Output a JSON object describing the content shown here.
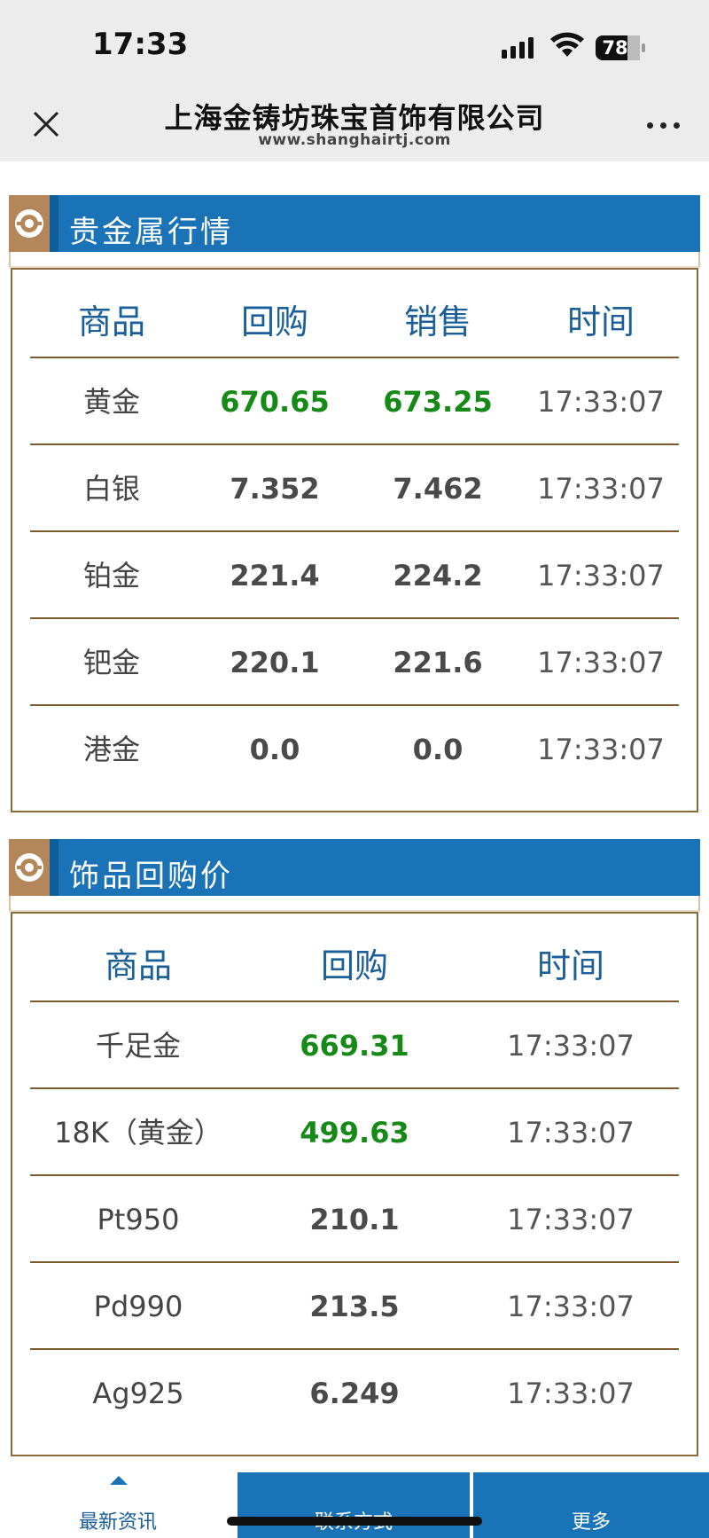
{
  "status_bar": {
    "time": "17:33",
    "battery": "78"
  },
  "header": {
    "title": "上海金铸坊珠宝首饰有限公司",
    "url": "www.shanghairtj.com"
  },
  "precious_metals": {
    "title": "贵金属行情",
    "columns": [
      "商品",
      "回购",
      "销售",
      "时间"
    ],
    "rows": [
      {
        "name": "黄金",
        "buyback": "670.65",
        "sale": "673.25",
        "time": "17:33:07",
        "highlight": true
      },
      {
        "name": "白银",
        "buyback": "7.352",
        "sale": "7.462",
        "time": "17:33:07",
        "highlight": false
      },
      {
        "name": "铂金",
        "buyback": "221.4",
        "sale": "224.2",
        "time": "17:33:07",
        "highlight": false
      },
      {
        "name": "钯金",
        "buyback": "220.1",
        "sale": "221.6",
        "time": "17:33:07",
        "highlight": false
      },
      {
        "name": "港金",
        "buyback": "0.0",
        "sale": "0.0",
        "time": "17:33:07",
        "highlight": false
      }
    ]
  },
  "jewelry_buyback": {
    "title": "饰品回购价",
    "columns": [
      "商品",
      "回购",
      "时间"
    ],
    "rows": [
      {
        "name": "千足金",
        "buyback": "669.31",
        "time": "17:33:07",
        "highlight": true
      },
      {
        "name": "18K（黄金）",
        "buyback": "499.63",
        "time": "17:33:07",
        "highlight": true
      },
      {
        "name": "Pt950",
        "buyback": "210.1",
        "time": "17:33:07",
        "highlight": false
      },
      {
        "name": "Pd990",
        "buyback": "213.5",
        "time": "17:33:07",
        "highlight": false
      },
      {
        "name": "Ag925",
        "buyback": "6.249",
        "time": "17:33:07",
        "highlight": false
      }
    ]
  },
  "bottom_nav": {
    "news": "最新资讯",
    "contact": "联系方式",
    "more": "更多"
  },
  "colors": {
    "accent_blue": "#1a73b6",
    "gold_border": "#8a6b3a",
    "price_green": "#168a16",
    "header_text": "#1a5f9a"
  }
}
